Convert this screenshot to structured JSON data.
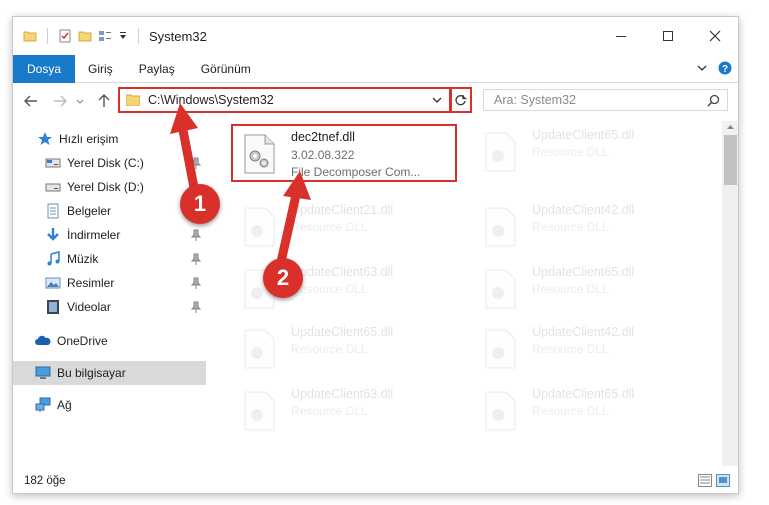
{
  "window": {
    "title": "System32",
    "ribbon_tabs": [
      {
        "label": "Dosya"
      },
      {
        "label": "Giriş"
      },
      {
        "label": "Paylaş"
      },
      {
        "label": "Görünüm"
      }
    ]
  },
  "address": {
    "path": "C:\\Windows\\System32",
    "search_placeholder": "Ara: System32"
  },
  "nav": {
    "items": [
      {
        "label": "Hızlı erişim",
        "icon": "star-icon"
      },
      {
        "label": "Yerel Disk (C:)",
        "icon": "drive-icon"
      },
      {
        "label": "Yerel Disk (D:)",
        "icon": "drive-icon"
      },
      {
        "label": "Belgeler",
        "icon": "documents-icon"
      },
      {
        "label": "İndirmeler",
        "icon": "downloads-icon"
      },
      {
        "label": "Müzik",
        "icon": "music-icon"
      },
      {
        "label": "Resimler",
        "icon": "pictures-icon"
      },
      {
        "label": "Videolar",
        "icon": "videos-icon"
      },
      {
        "label": "OneDrive",
        "icon": "cloud-icon"
      },
      {
        "label": "Bu bilgisayar",
        "icon": "computer-icon"
      },
      {
        "label": "Ağ",
        "icon": "network-icon"
      }
    ]
  },
  "files": [
    {
      "name": "dec2tnef.dll",
      "version": "3.02.08.322",
      "desc": "File Decomposer Com..."
    },
    {
      "name": "UpdateClient65.dll",
      "version": "",
      "desc": "Resource DLL"
    },
    {
      "name": "UpdateClient21.dll",
      "version": "",
      "desc": "Resource DLL"
    },
    {
      "name": "UpdateClient42.dll",
      "version": "",
      "desc": "Resource DLL"
    },
    {
      "name": "UpdateClient63.dll",
      "version": "",
      "desc": "Resource DLL"
    },
    {
      "name": "UpdateClient65.dll",
      "version": "",
      "desc": "Resource DLL"
    },
    {
      "name": "UpdateClient65.dll",
      "version": "",
      "desc": "Resource DLL"
    },
    {
      "name": "UpdateClient42.dll",
      "version": "",
      "desc": "Resource DLL"
    },
    {
      "name": "UpdateClient63.dll",
      "version": "",
      "desc": "Resource DLL"
    },
    {
      "name": "UpdateClient65.dll",
      "version": "",
      "desc": "Resource DLL"
    }
  ],
  "status": {
    "item_count": "182 öğe"
  },
  "annotations": {
    "step1": "1",
    "step2": "2"
  },
  "colors": {
    "accent": "#1979ca",
    "highlight": "#d9302b",
    "selected": "#d9d9d9"
  }
}
